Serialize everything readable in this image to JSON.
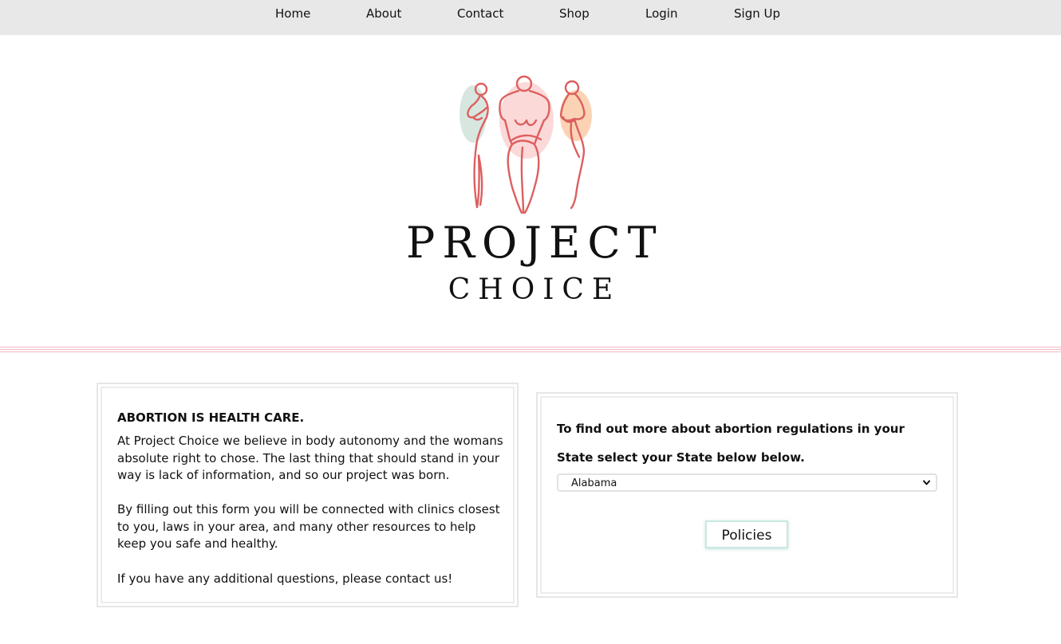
{
  "nav": {
    "items": [
      "Home",
      "About",
      "Contact",
      "Shop",
      "Login",
      "Sign Up"
    ]
  },
  "logo": {
    "title": "PROJECT",
    "subtitle": "CHOICE",
    "colors": {
      "line": "#dd5f5f",
      "blob_sage": "#d8e6e0",
      "blob_pink": "#fbd9d8",
      "blob_peach": "#fbd3b4"
    }
  },
  "divider_color": "#f3b8c0",
  "info": {
    "heading": "ABORTION IS HEALTH CARE.",
    "paragraphs": [
      "At Project Choice we believe in body autonomy and the womans absolute right to chose. The last thing that should stand in your way is lack of information, and so our project was born.",
      "By filling out this form you will be connected with clinics closest to you, laws in your area, and many other resources to help keep you safe and healthy.",
      "If you have any additional questions, please contact us!"
    ]
  },
  "state_finder": {
    "prompt": "To find out more about abortion regulations in your State select your State below below.",
    "selected_state": "Alabama",
    "button_label": "Policies"
  }
}
